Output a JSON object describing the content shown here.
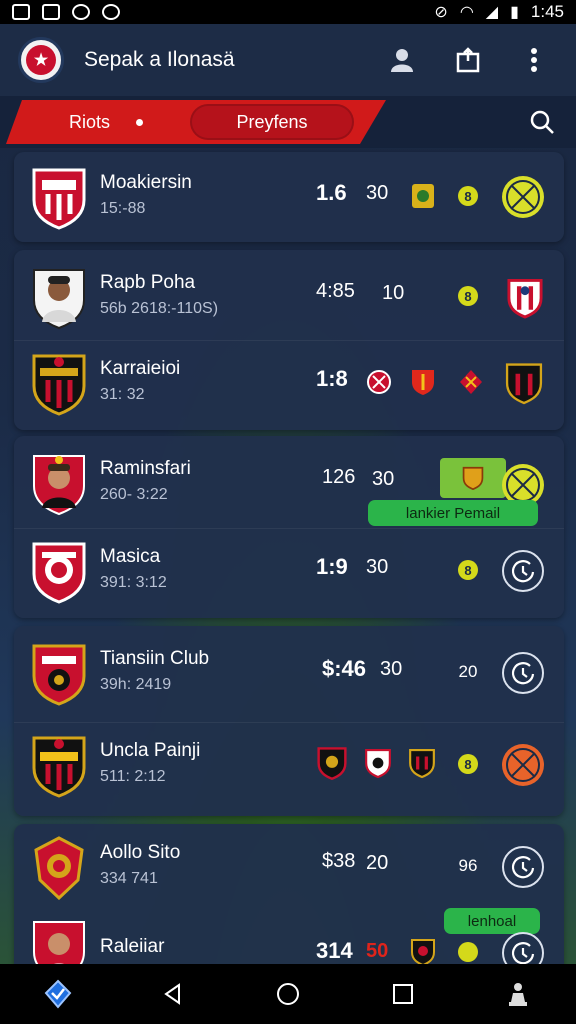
{
  "status_bar": {
    "time": "1:45"
  },
  "app": {
    "title": "Sepak a Ilonasä"
  },
  "tabs": {
    "tab1": "Riots",
    "tab2": "Preyfens"
  },
  "colors": {
    "accent_red": "#d11a1a",
    "green": "#2bb44a",
    "lime": "#d9df2a"
  },
  "rows": [
    {
      "name": "Moakiersin",
      "sub": "15:-88",
      "score": "1.6",
      "num": "30"
    },
    {
      "name": "Rapb Poha",
      "sub": "56b 2618:-110S)",
      "score": "4:85",
      "num": "10"
    },
    {
      "name": "Karraieioi",
      "sub": "31: 32",
      "score": "1:8",
      "num": ""
    },
    {
      "name": "Raminsfari",
      "sub": "260- 3:22",
      "score": "126",
      "num": "30"
    },
    {
      "name": "Masica",
      "sub": "391: 3:12",
      "score": "1:9",
      "num": "30"
    },
    {
      "name": "Tiansiin Club",
      "sub": "39h: 2419",
      "score": "$:46",
      "num": "30"
    },
    {
      "name": "Uncla Painji",
      "sub": "511: 2:12",
      "score": "",
      "num": ""
    },
    {
      "name": "Aollo Sito",
      "sub": "334 741",
      "score": "$38",
      "num": "20"
    },
    {
      "name": "Raleiiar",
      "sub": "",
      "score": "314",
      "num": "50"
    }
  ],
  "chips": {
    "c1": "8",
    "c2": "8",
    "c4": "8",
    "c5": "20",
    "c6": "8",
    "c7": "96"
  },
  "pills": {
    "p1": "lankier Pemail",
    "p2": "lenhoal"
  }
}
